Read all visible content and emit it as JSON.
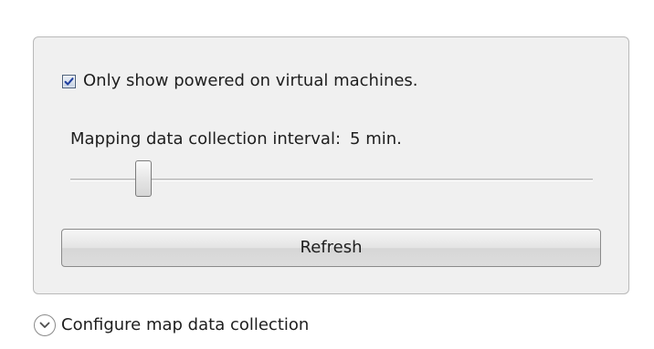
{
  "settings": {
    "show_powered_on_label": "Only show powered on virtual machines.",
    "show_powered_on_checked": true,
    "interval_label": "Mapping data collection interval:",
    "interval_value": "5 min.",
    "slider_level_fraction": 0.14,
    "refresh_label": "Refresh"
  },
  "footer": {
    "collapse_label": "Configure map data collection",
    "collapse_icon": "chevron-down-icon"
  },
  "icons": {
    "checkbox": "checkmark-icon",
    "checkmark_color": "#1f3f9f",
    "panel_bg": "#f0f0f0"
  }
}
